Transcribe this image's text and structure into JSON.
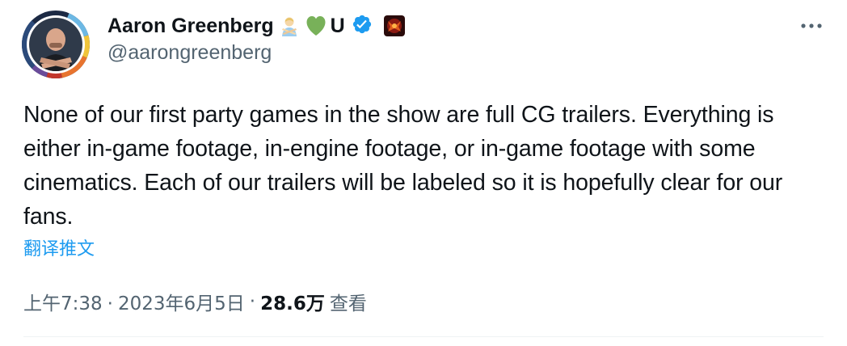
{
  "author": {
    "display_name": "Aaron Greenberg",
    "name_emojis": [
      "person-gesturing-no-emoji",
      "green-heart-emoji"
    ],
    "name_suffix": "U",
    "verified": true,
    "affiliation_badge": "xbox-game-badge-icon",
    "handle": "@aarongreenberg",
    "avatar": "avatar-photo"
  },
  "tweet": {
    "text": "None of our first party games in the show are full CG trailers. Everything is either in-game footage, in-engine footage, or in-game footage with some cinematics. Each of our trailers will be labeled so it is hopefully clear for our fans.",
    "translate_label": "翻译推文",
    "time": "上午7:38",
    "date": "2023年6月5日",
    "separator": "·",
    "views_count": "28.6万",
    "views_label": "查看"
  },
  "actions": {
    "more_icon": "more-horizontal-icon"
  },
  "colors": {
    "text_primary": "#0f1419",
    "text_secondary": "#536471",
    "link": "#1d9bf0",
    "verified": "#1d9bf0",
    "divider": "#eff3f4",
    "heart": "#78b159"
  }
}
